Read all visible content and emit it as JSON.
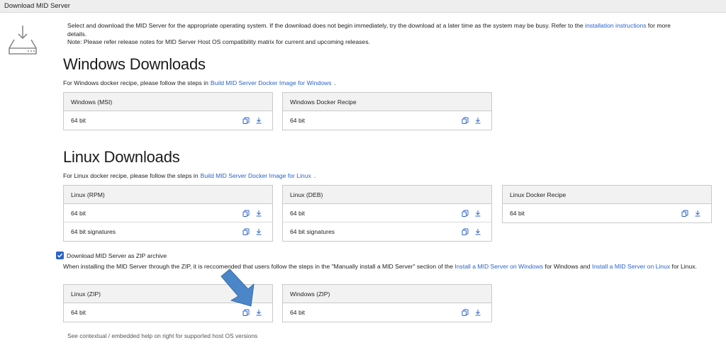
{
  "window": {
    "title": "Download MID Server"
  },
  "intro": {
    "text1": "Select and download the MID Server for the appropriate operating system. If the download does not begin immediately, try the download at a later time as the system may be busy. Refer to the ",
    "link": "installation instructions",
    "text2": " for more details.",
    "note": "Note: Please refer release notes for MID Server Host OS compatibility matrix for current and upcoming releases."
  },
  "windows": {
    "title": "Windows Downloads",
    "docker_prefix": "For Windows docker recipe, please follow the steps in",
    "docker_link": "Build MID Server Docker Image for Windows",
    "docker_suffix": ".",
    "cards": [
      {
        "title": "Windows (MSI)",
        "rows": [
          "64 bit"
        ]
      },
      {
        "title": "Windows Docker Recipe",
        "rows": [
          "64 bit"
        ]
      }
    ]
  },
  "linux": {
    "title": "Linux Downloads",
    "docker_prefix": "For Linux docker recipe, please follow the steps in",
    "docker_link": "Build MID Server Docker Image for Linux",
    "docker_suffix": ".",
    "cards": [
      {
        "title": "Linux (RPM)",
        "rows": [
          "64 bit",
          "64 bit signatures"
        ]
      },
      {
        "title": "Linux (DEB)",
        "rows": [
          "64 bit",
          "64 bit signatures"
        ]
      },
      {
        "title": "Linux Docker Recipe",
        "rows": [
          "64 bit"
        ]
      }
    ]
  },
  "zip": {
    "checkbox_label": "Download MID Server as ZIP archive",
    "checked": true,
    "note_text1": "When installing the MID Server through the ZIP, it is reccomended that users follow the steps in the \"Manually install a MID Server\" section of the ",
    "note_link1": "Install a MID Server on Windows",
    "note_text2": " for Windows and ",
    "note_link2": "Install a MID Server on Linux",
    "note_text3": " for Linux.",
    "cards": [
      {
        "title": "Linux (ZIP)",
        "rows": [
          "64 bit"
        ]
      },
      {
        "title": "Windows (ZIP)",
        "rows": [
          "64 bit"
        ]
      }
    ]
  },
  "footer": {
    "text": "See contextual / embedded help on right for supported host OS versions"
  },
  "icons": {
    "copy": "copy-icon",
    "download": "download-icon",
    "server": "server-download-icon",
    "annotation": "arrow-annotation"
  },
  "colors": {
    "link": "#2a62c9",
    "arrow": "#4a86c8",
    "header_bg": "#f2f2f2"
  }
}
